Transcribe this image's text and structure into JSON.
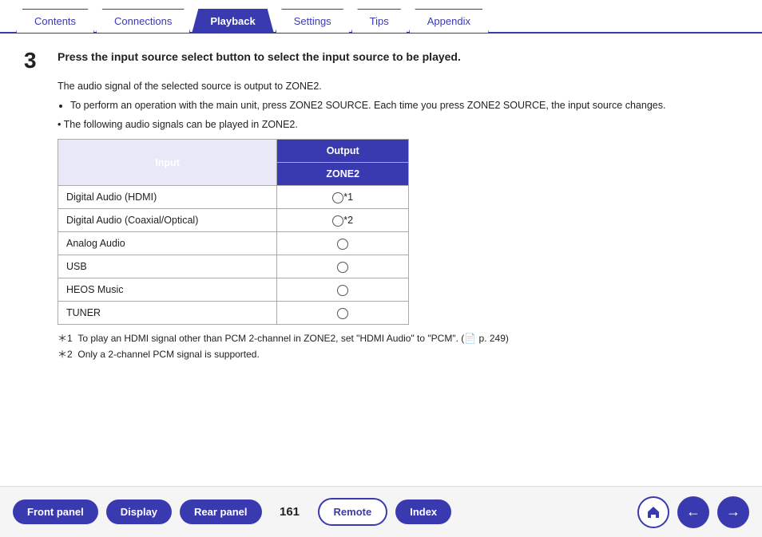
{
  "tabs": [
    {
      "label": "Contents",
      "active": false
    },
    {
      "label": "Connections",
      "active": false
    },
    {
      "label": "Playback",
      "active": true
    },
    {
      "label": "Settings",
      "active": false
    },
    {
      "label": "Tips",
      "active": false
    },
    {
      "label": "Appendix",
      "active": false
    }
  ],
  "step": {
    "number": "3",
    "title": "Press the input source select button to select the input source to be played.",
    "body_line1": "The audio signal of the selected source is output to ZONE2.",
    "bullet1": "To perform an operation with the main unit, press ZONE2 SOURCE. Each time you press ZONE2 SOURCE, the input source changes.",
    "intro_line": "The following audio signals can be played in ZONE2."
  },
  "table": {
    "header_input": "Input",
    "header_output": "Output",
    "header_zone": "ZONE2",
    "rows": [
      {
        "input": "Digital Audio (HDMI)",
        "has_circle": true,
        "note": "*1"
      },
      {
        "input": "Digital Audio (Coaxial/Optical)",
        "has_circle": true,
        "note": "*2"
      },
      {
        "input": "Analog Audio",
        "has_circle": true,
        "note": ""
      },
      {
        "input": "USB",
        "has_circle": true,
        "note": ""
      },
      {
        "input": "HEOS Music",
        "has_circle": true,
        "note": ""
      },
      {
        "input": "TUNER",
        "has_circle": true,
        "note": ""
      }
    ]
  },
  "footnotes": [
    {
      "mark": "*1",
      "text": "To play an HDMI signal other than PCM 2-channel in ZONE2, set \"HDMI Audio\" to \"PCM\". (",
      "page": "p. 249",
      "end": ")"
    },
    {
      "mark": "*2",
      "text": "Only a 2-channel PCM signal is supported."
    }
  ],
  "bottom": {
    "front_panel": "Front panel",
    "display": "Display",
    "rear_panel": "Rear panel",
    "page_number": "161",
    "remote": "Remote",
    "index": "Index"
  }
}
